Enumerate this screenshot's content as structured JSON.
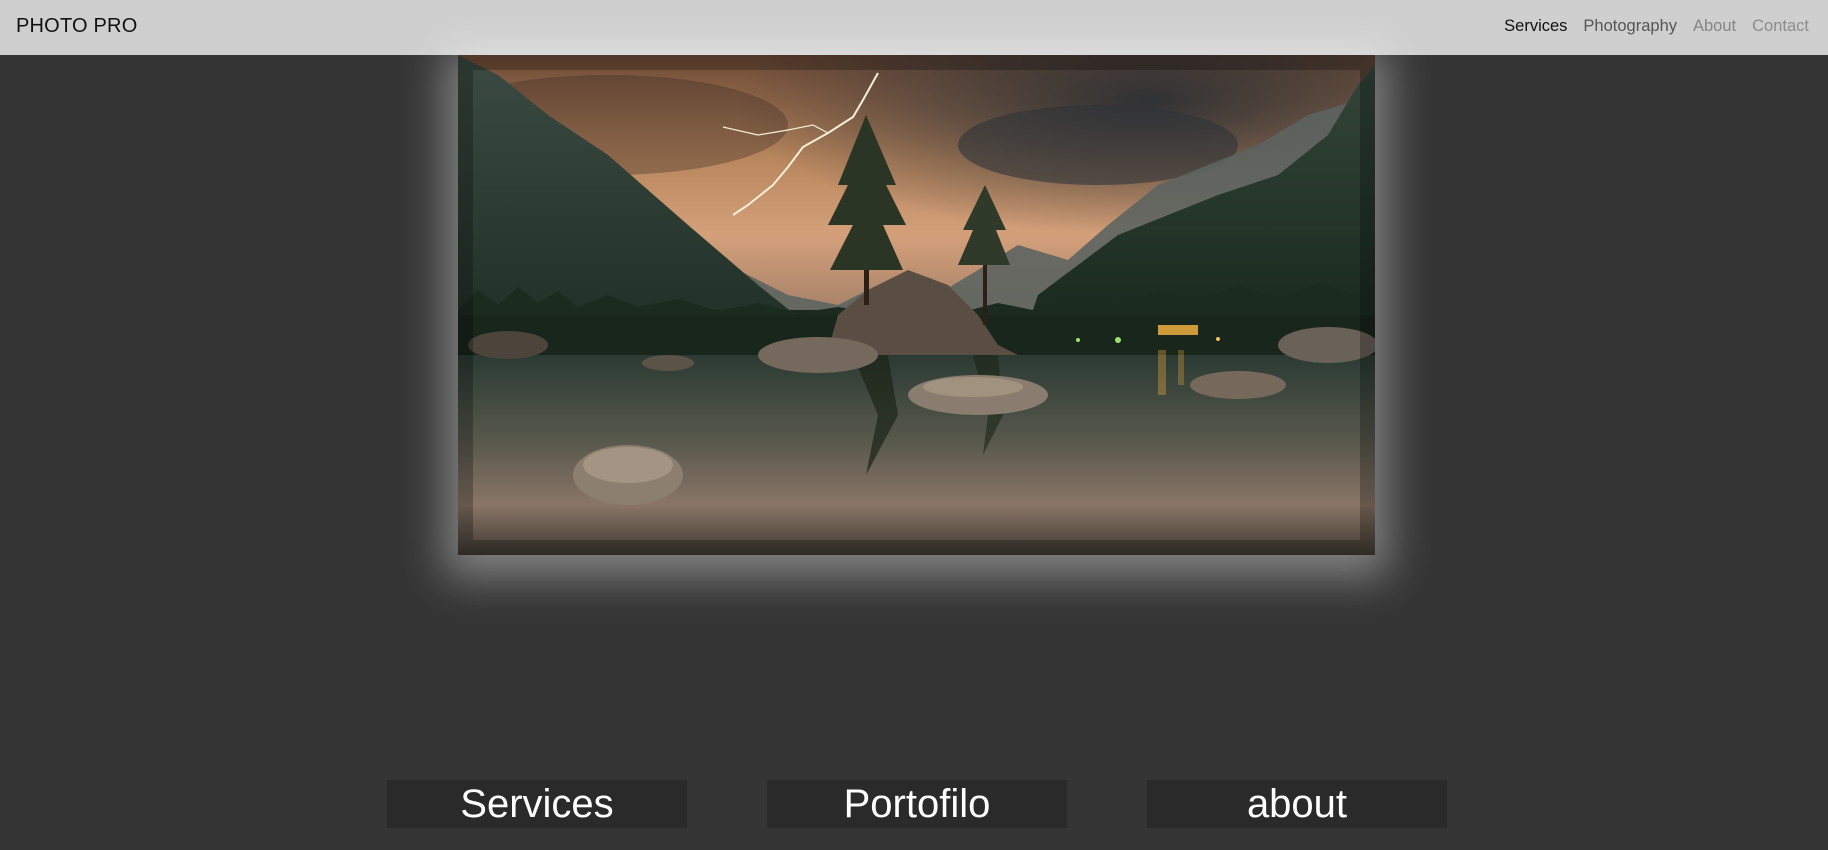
{
  "header": {
    "brand": "PHOTO PRO",
    "nav": [
      {
        "label": "Services"
      },
      {
        "label": "Photography"
      },
      {
        "label": "About"
      },
      {
        "label": "Contact"
      }
    ]
  },
  "hero": {
    "image": "landscape-photo",
    "description_icon": "lake-mountains-lightning"
  },
  "cards": [
    {
      "label": "Services"
    },
    {
      "label": "Portofilo"
    },
    {
      "label": "about"
    }
  ],
  "colors": {
    "page_bg": "#353535",
    "header_bg": "#cfcfcf",
    "card_bg": "#2a2a2a",
    "card_text": "#ffffff"
  }
}
